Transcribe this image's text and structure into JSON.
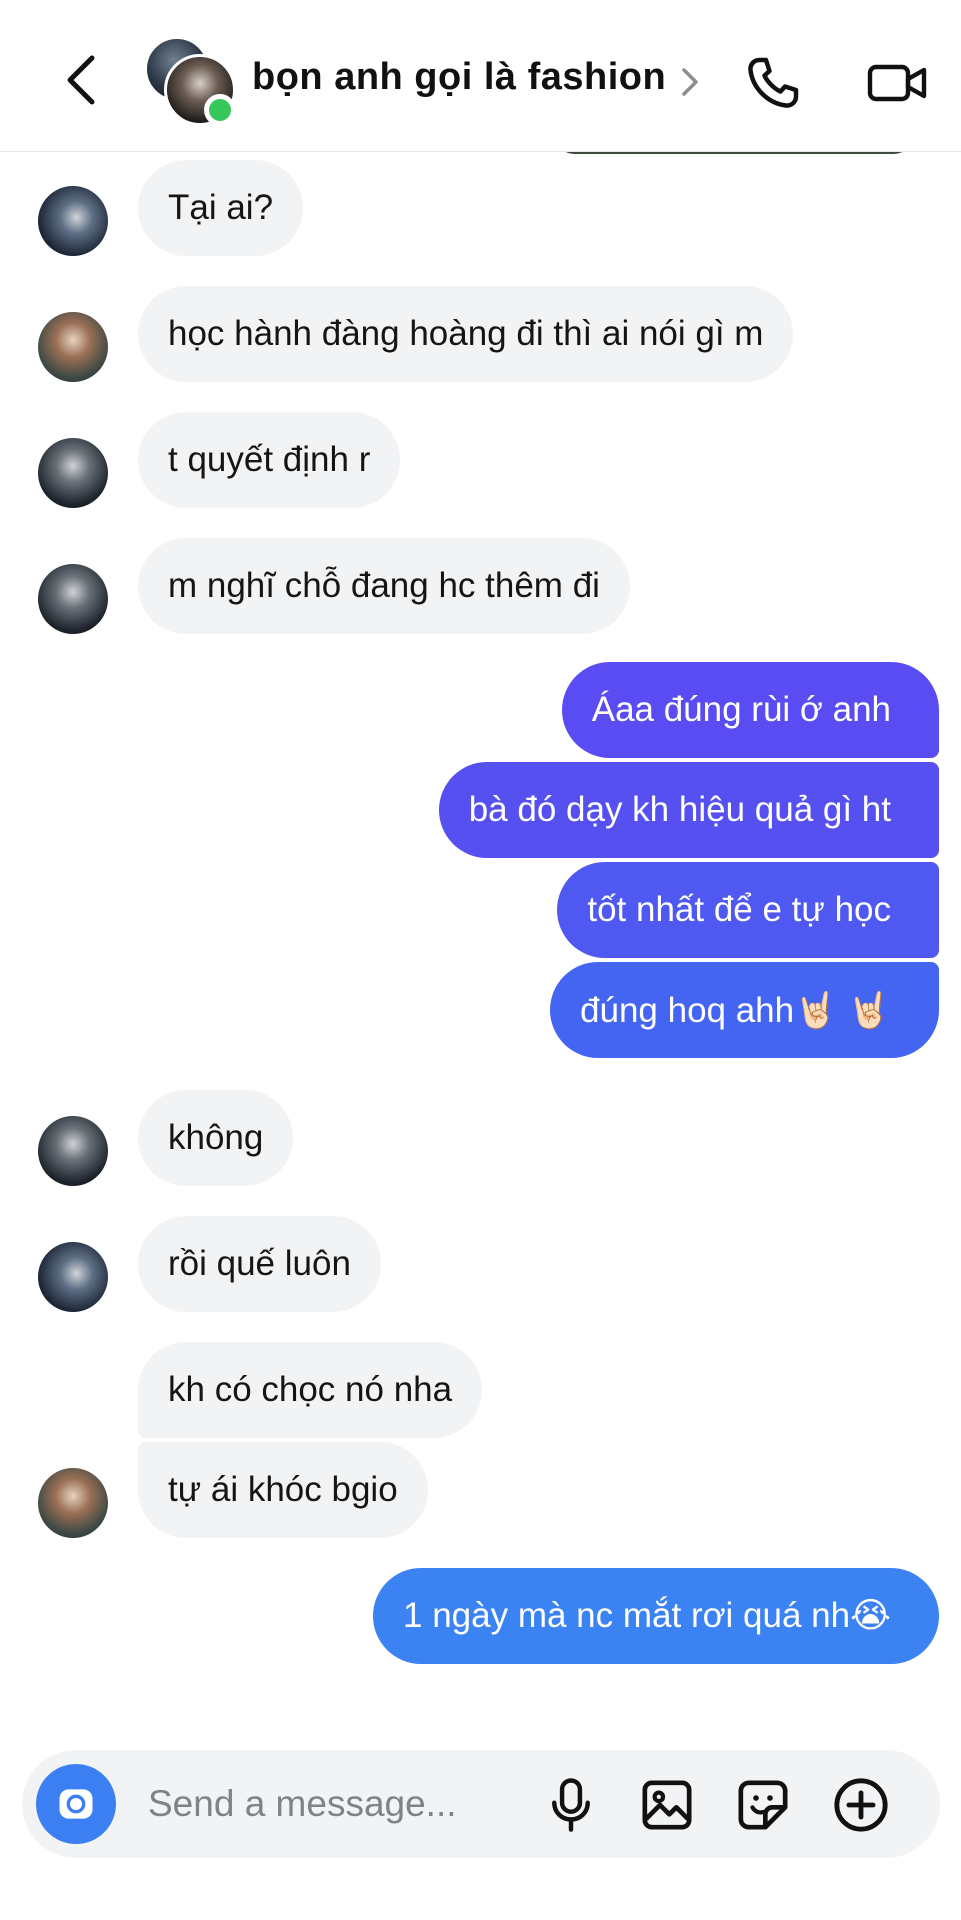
{
  "header": {
    "title": "bọn anh gọi là fashion"
  },
  "messages": [
    {
      "side": "in",
      "text": "Tại ai?"
    },
    {
      "side": "in",
      "text": "học hành đàng hoàng đi thì ai nói gì m"
    },
    {
      "side": "in",
      "text": "t quyết định r"
    },
    {
      "side": "in",
      "text": "m nghĩ chỗ đang hc thêm đi"
    },
    {
      "side": "out",
      "text": "Áaa đúng rùi ớ anh"
    },
    {
      "side": "out",
      "text": "bà đó dạy kh hiệu quả gì ht"
    },
    {
      "side": "out",
      "text": "tốt nhất để e tự học"
    },
    {
      "side": "out",
      "text": "đúng hoq ahh🤘🏻 🤘🏻"
    },
    {
      "side": "in",
      "text": "không"
    },
    {
      "side": "in",
      "text": "rồi quế luôn"
    },
    {
      "side": "in",
      "text": "kh có chọc nó nha"
    },
    {
      "side": "in",
      "text": "tự ái khóc bgio"
    },
    {
      "side": "out",
      "text": "1 ngày mà nc mắt rơi quá nh😭"
    }
  ],
  "composer": {
    "placeholder": "Send a message..."
  },
  "colors": {
    "accent": "#3b82f3",
    "outgoing_top": "#5a4cf3",
    "incoming_bubble": "#f2f3f5",
    "online": "#35c759"
  },
  "icons": [
    "back-arrow-icon",
    "chevron-right-icon",
    "phone-icon",
    "video-camera-icon",
    "camera-icon",
    "microphone-icon",
    "image-icon",
    "sticker-icon",
    "plus-circle-icon"
  ]
}
